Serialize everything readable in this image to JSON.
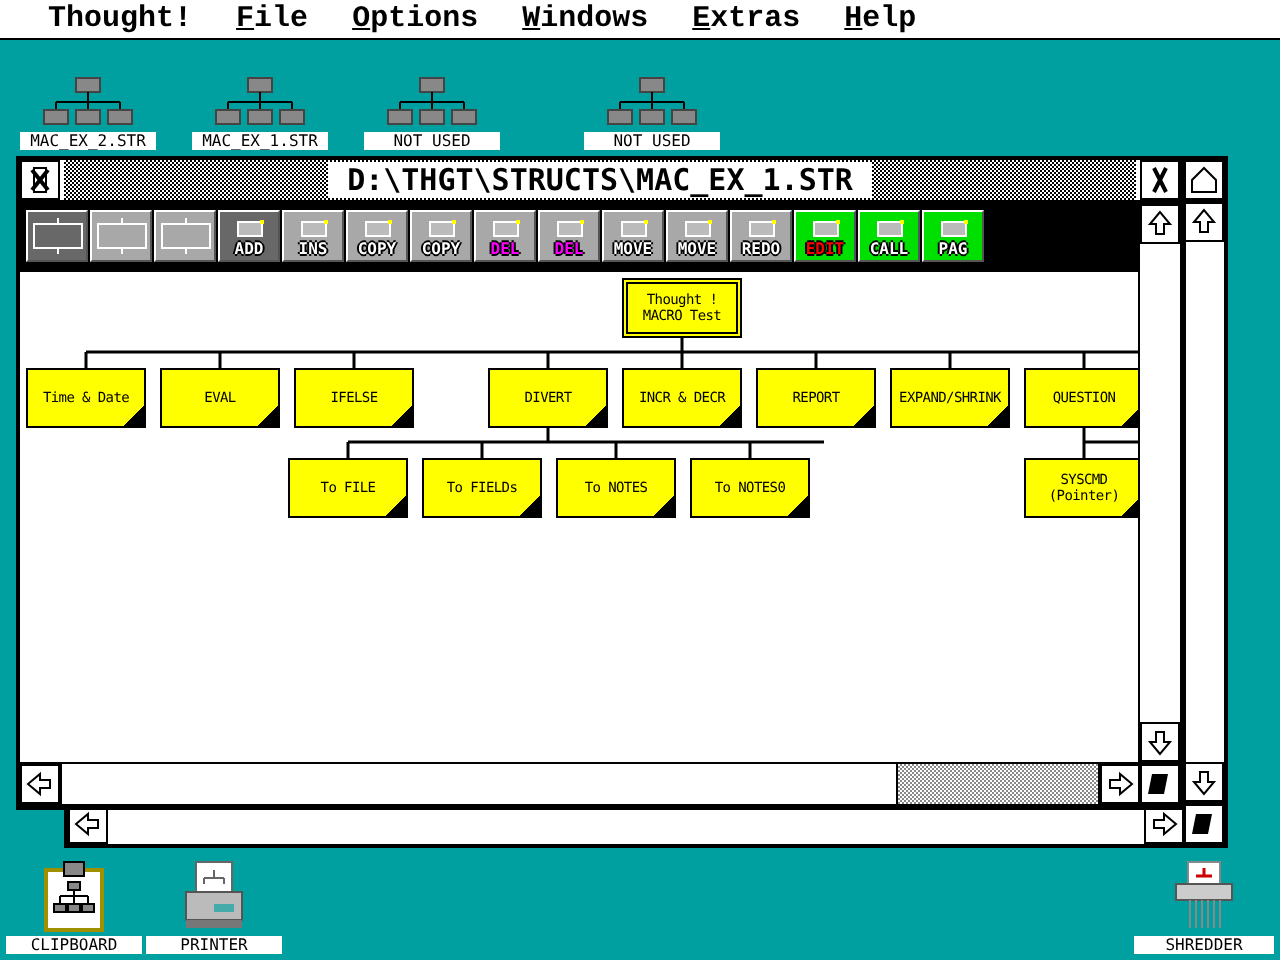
{
  "menu_bar": [
    {
      "label": "Thought!",
      "underlined": false
    },
    {
      "label": "File",
      "underlined": true
    },
    {
      "label": "Options",
      "underlined": true
    },
    {
      "label": "Windows",
      "underlined": true
    },
    {
      "label": "Extras",
      "underlined": true
    },
    {
      "label": "Help",
      "underlined": true
    }
  ],
  "desktop_files": [
    {
      "label": "MAC_EX_2.STR"
    },
    {
      "label": "MAC_EX_1.STR"
    },
    {
      "label": "NOT USED"
    },
    {
      "label": "NOT USED"
    }
  ],
  "desktop_tools": [
    {
      "label": "CLIPBOARD",
      "kind": "clipboard"
    },
    {
      "label": "PRINTER",
      "kind": "printer"
    },
    {
      "label": "SHREDDER",
      "kind": "shredder"
    }
  ],
  "window": {
    "title": "D:\\THGT\\STRUCTS\\MAC_EX_1.STR"
  },
  "toolbar": [
    {
      "kind": "layout",
      "selected": true
    },
    {
      "kind": "layout",
      "selected": false
    },
    {
      "kind": "layout",
      "selected": false
    },
    {
      "kind": "command",
      "label": "ADD",
      "color": "#ffffff",
      "selected": true
    },
    {
      "kind": "command",
      "label": "INS",
      "color": "#ffffff",
      "selected": false
    },
    {
      "kind": "command",
      "label": "COPY",
      "color": "#ffffff",
      "selected": false
    },
    {
      "kind": "command",
      "label": "COPY",
      "color": "#ffffff",
      "selected": false
    },
    {
      "kind": "command",
      "label": "DEL",
      "color": "#ff00ff",
      "selected": false
    },
    {
      "kind": "command",
      "label": "DEL",
      "color": "#ff00ff",
      "selected": false
    },
    {
      "kind": "command",
      "label": "MOVE",
      "color": "#ffffff",
      "selected": false
    },
    {
      "kind": "command",
      "label": "MOVE",
      "color": "#ffffff",
      "selected": false
    },
    {
      "kind": "command",
      "label": "REDO",
      "color": "#ffffff",
      "selected": false
    },
    {
      "kind": "mode",
      "label": "EDIT",
      "color": "#ff0000",
      "selected": false
    },
    {
      "kind": "mode",
      "label": "CALL",
      "color": "#ffffff",
      "selected": false
    },
    {
      "kind": "mode",
      "label": "PAG",
      "color": "#ffffff",
      "selected": false
    }
  ],
  "tree": {
    "label": "Thought !\nMACRO Test",
    "children": [
      {
        "label": "Time & Date"
      },
      {
        "label": "EVAL"
      },
      {
        "label": "IFELSE"
      },
      {
        "label": "DIVERT",
        "children": [
          {
            "label": "To FILE"
          },
          {
            "label": "To FIELDs"
          },
          {
            "label": "To NOTES"
          },
          {
            "label": "To NOTES0"
          }
        ]
      },
      {
        "label": "INCR & DECR"
      },
      {
        "label": "REPORT"
      },
      {
        "label": "EXPAND/SHRINK"
      },
      {
        "label": "QUESTION",
        "children": [
          {
            "label": "SYSCMD\n(Pointer)"
          }
        ]
      }
    ]
  }
}
